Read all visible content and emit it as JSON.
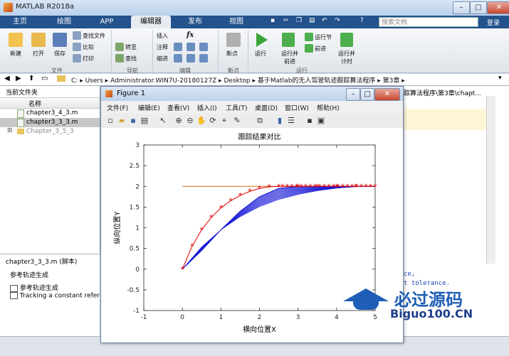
{
  "window": {
    "title": "MATLAB R2018a",
    "minimize": "–",
    "maximize": "□",
    "close": "✕"
  },
  "tabs": [
    "主页",
    "绘图",
    "APP",
    "编辑器",
    "发布",
    "视图"
  ],
  "search": {
    "placeholder": "搜索文档",
    "login": "登录"
  },
  "ribbon": {
    "file": {
      "new": "新建",
      "open": "打开",
      "save": "保存",
      "find_files": "查找文件",
      "compare": "比较",
      "print": "打印",
      "section": "文件"
    },
    "navigate": {
      "goto": "转至",
      "find": "查找",
      "section": "导航"
    },
    "edit": {
      "insert": "插入",
      "comment": "注释",
      "indent": "缩进",
      "fx": "fx",
      "section": "编辑"
    },
    "breakpoints": {
      "label": "断点",
      "section": "断点"
    },
    "run": {
      "run": "运行",
      "run_advance": "运行并前进",
      "run_section": "运行节",
      "advance": "前进",
      "run_time": "运行并计时",
      "section": "运行"
    }
  },
  "path": {
    "segments": [
      "C:",
      "Users",
      "Administrator.WIN7U-20180127Z",
      "Desktop",
      "基于Matlab的无人驾驶轨迹跟踪算法程序",
      "第3章"
    ],
    "right_fragment": "踪算法程序\\第3章\\chapt..."
  },
  "current_folder": {
    "header": "当前文件夹",
    "col_name": "名称",
    "files": [
      "chapter3_4_3.m",
      "chapter3_3_3.m",
      "Chapter_3_5_3"
    ]
  },
  "details": {
    "filename": "chapter3_3_3.m  (脚本)",
    "heading": "参考轨迹生成",
    "items": [
      "参考轨迹生成",
      "Tracking a constant refere"
    ]
  },
  "code_fragments": [
    "ce,",
    "t tolerance."
  ],
  "figure": {
    "title": "Figure 1",
    "menus": [
      "文件(F)",
      "编辑(E)",
      "查看(V)",
      "插入(I)",
      "工具(T)",
      "桌面(D)",
      "窗口(W)",
      "帮助(H)"
    ]
  },
  "chart_data": {
    "type": "line",
    "title": "跟踪结果对比",
    "xlabel": "横向位置X",
    "ylabel": "纵向位置Y",
    "xlim": [
      -1,
      5
    ],
    "ylim": [
      -1,
      3
    ],
    "xticks": [
      -1,
      0,
      1,
      2,
      3,
      4,
      5
    ],
    "yticks": [
      -1,
      -0.5,
      0,
      0.5,
      1,
      1.5,
      2,
      2.5,
      3
    ],
    "grid": false,
    "legend": "none",
    "series": [
      {
        "color": "#d06a1c",
        "x": [
          0,
          5
        ],
        "y": [
          2,
          2
        ]
      },
      {
        "color": "#e00000",
        "marker": "asterisk",
        "x": [
          0,
          0.25,
          0.5,
          0.75,
          1.0,
          1.25,
          1.5,
          1.75,
          2.0,
          2.25,
          2.5,
          3,
          3.5,
          4,
          4.5,
          5
        ],
        "y": [
          0,
          0.55,
          0.95,
          1.25,
          1.48,
          1.65,
          1.78,
          1.88,
          1.95,
          1.99,
          2,
          2,
          2,
          2,
          2,
          2
        ]
      },
      {
        "color": "#1a1ad8",
        "x": [
          0,
          0.5,
          1.0,
          1.5,
          2.0,
          2.5,
          3,
          3.5,
          4,
          4.5,
          5
        ],
        "y": [
          0,
          0.45,
          0.95,
          1.4,
          1.75,
          1.95,
          2,
          2,
          2,
          2,
          2
        ]
      }
    ]
  },
  "watermark": {
    "cn": "必过源码",
    "en": "Biguo100.CN"
  },
  "colors": {
    "ribbon_tab_bar": "#23528c",
    "reference": "#d06a1c",
    "actual": "#e00000",
    "predicted": "#1a1ad8"
  }
}
